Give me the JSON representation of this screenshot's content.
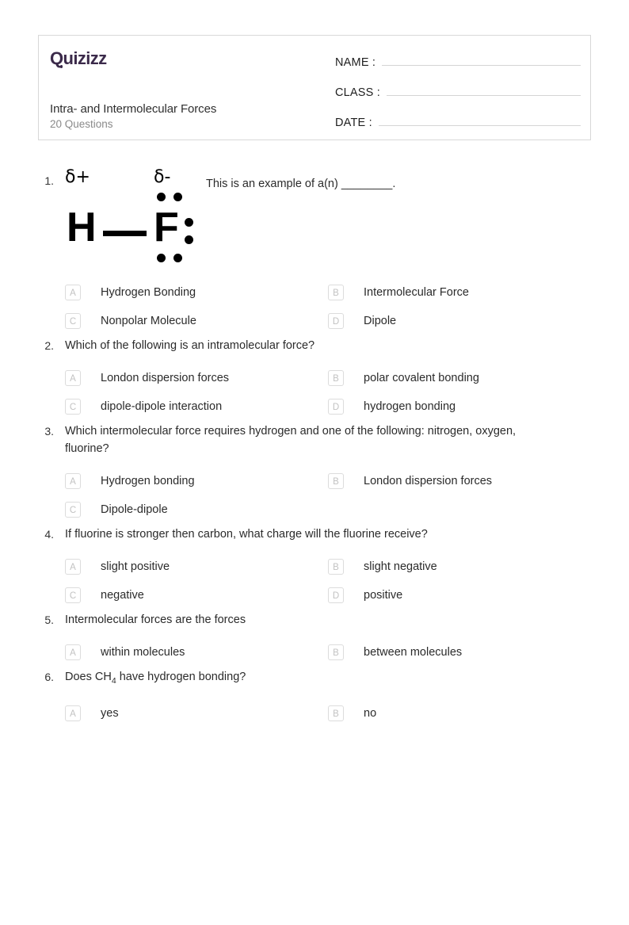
{
  "header": {
    "logo_text": "Quizizz",
    "quiz_title": "Intra- and Intermolecular Forces",
    "question_count_label": "20 Questions",
    "fields": [
      {
        "label": "NAME :",
        "value": ""
      },
      {
        "label": "CLASS :",
        "value": ""
      },
      {
        "label": "DATE  :",
        "value": ""
      }
    ]
  },
  "figure": {
    "delta_plus": "δ+",
    "delta_minus": "δ-",
    "atom_left": "H",
    "atom_right": "F"
  },
  "questions": [
    {
      "number": "1.",
      "text_before": "This is an example of a(n) ________.",
      "has_figure": true,
      "options": [
        {
          "letter": "A",
          "text": "Hydrogen Bonding"
        },
        {
          "letter": "B",
          "text": "Intermolecular Force"
        },
        {
          "letter": "C",
          "text": "Nonpolar Molecule"
        },
        {
          "letter": "D",
          "text": "Dipole"
        }
      ]
    },
    {
      "number": "2.",
      "text": "Which of the following is an intramolecular force?",
      "has_figure": false,
      "options": [
        {
          "letter": "A",
          "text": "London dispersion forces"
        },
        {
          "letter": "B",
          "text": "polar covalent bonding"
        },
        {
          "letter": "C",
          "text": "dipole-dipole interaction"
        },
        {
          "letter": "D",
          "text": "hydrogen bonding"
        }
      ]
    },
    {
      "number": "3.",
      "text": "Which intermolecular force requires hydrogen and one of the following: nitrogen, oxygen, fluorine?",
      "has_figure": false,
      "options": [
        {
          "letter": "A",
          "text": "Hydrogen bonding"
        },
        {
          "letter": "B",
          "text": "London dispersion forces"
        },
        {
          "letter": "C",
          "text": "Dipole-dipole"
        }
      ]
    },
    {
      "number": "4.",
      "text": "If fluorine is stronger then carbon, what charge will the fluorine receive?",
      "has_figure": false,
      "options": [
        {
          "letter": "A",
          "text": "slight positive"
        },
        {
          "letter": "B",
          "text": "slight negative"
        },
        {
          "letter": "C",
          "text": "negative"
        },
        {
          "letter": "D",
          "text": "positive"
        }
      ]
    },
    {
      "number": "5.",
      "text": "Intermolecular forces are the forces",
      "has_figure": false,
      "options": [
        {
          "letter": "A",
          "text": "within molecules"
        },
        {
          "letter": "B",
          "text": "between molecules"
        }
      ]
    },
    {
      "number": "6.",
      "text_html": "Does CH<sub>4</sub> have hydrogen bonding?",
      "text": "Does CH4 have hydrogen bonding?",
      "has_figure": false,
      "options": [
        {
          "letter": "A",
          "text": "yes"
        },
        {
          "letter": "B",
          "text": "no"
        }
      ]
    }
  ],
  "colors": {
    "logo": "#3b2a4a",
    "text": "#2b2b2b",
    "muted": "#8a8a8a",
    "border": "#d8d8d8",
    "option_letter": "#c2c2c2"
  }
}
